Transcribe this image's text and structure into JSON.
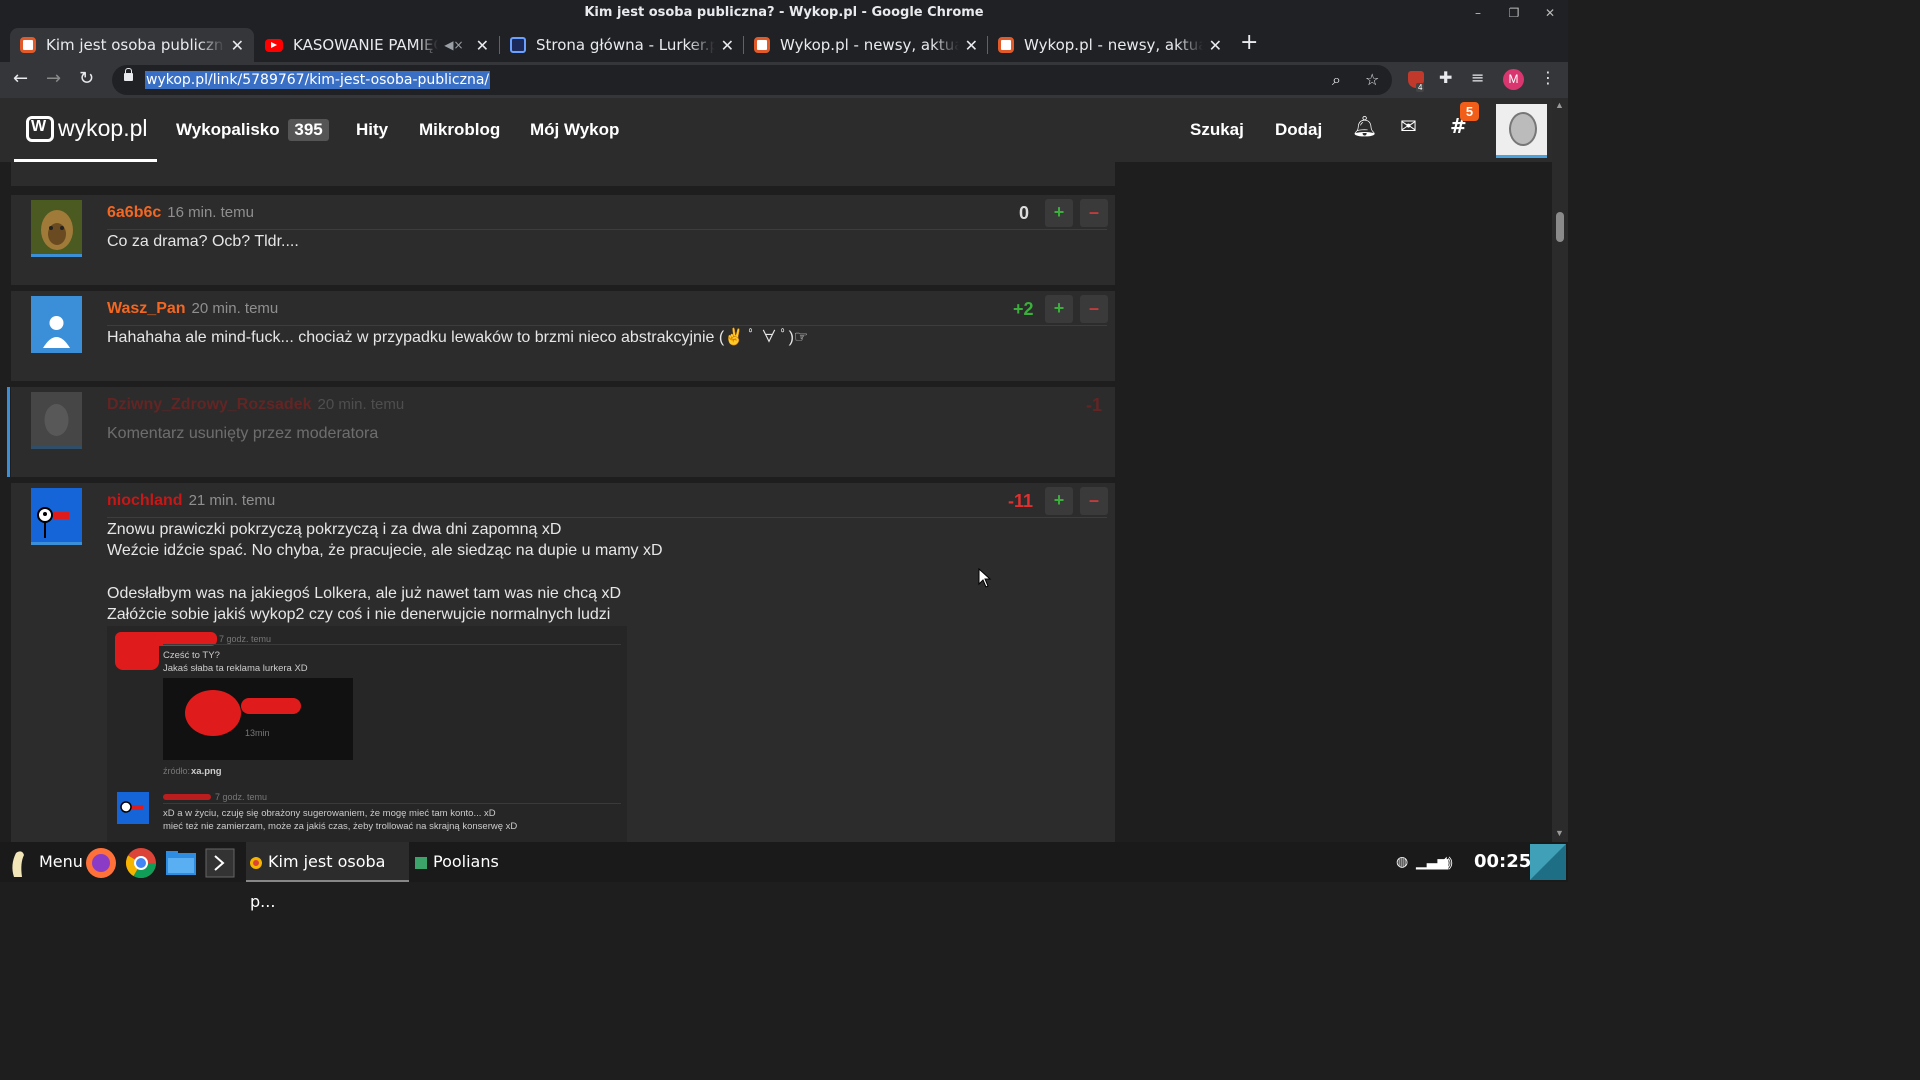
{
  "window": {
    "title": "Kim jest osoba publiczna? - Wykop.pl - Google Chrome"
  },
  "tabs": [
    {
      "label": "Kim jest osoba publiczna",
      "active": true,
      "icon": "wykop-favicon"
    },
    {
      "label": "KASOWANIE PAMIĘC",
      "active": false,
      "icon": "youtube-favicon",
      "muted": true
    },
    {
      "label": "Strona główna - Lurker.p",
      "active": false,
      "icon": "lurker-favicon"
    },
    {
      "label": "Wykop.pl - newsy, aktual",
      "active": false,
      "icon": "wykop-favicon"
    },
    {
      "label": "Wykop.pl - newsy, aktual",
      "active": false,
      "icon": "wykop-favicon"
    }
  ],
  "toolbar": {
    "url": "wykop.pl/link/5789767/kim-jest-osoba-publiczna/",
    "ublock_count": "4",
    "profile_initial": "M"
  },
  "site": {
    "logo_text": "wykop.pl",
    "nav": [
      {
        "label": "Wykopalisko",
        "badge": "395"
      },
      {
        "label": "Hity"
      },
      {
        "label": "Mikroblog"
      },
      {
        "label": "Mój Wykop"
      }
    ],
    "search_label": "Szukaj",
    "add_label": "Dodaj",
    "notif_count": "5"
  },
  "comments": [
    {
      "author": "6a6b6c",
      "time": "16 min. temu",
      "score": "0",
      "text": "Co za drama? Ocb? Tldr...."
    },
    {
      "author": "Wasz_Pan",
      "time": "20 min. temu",
      "score": "+2",
      "text": "Hahahaha ale mind-fuck... chociaż w przypadku lewaków to brzmi nieco abstrakcyjnie (✌ ﾟ ∀ ﾟ)☞"
    },
    {
      "author": "Dziwny_Zdrowy_Rozsadek",
      "time": "20 min. temu",
      "score": "-1",
      "text": "Komentarz usunięty przez moderatora",
      "deleted": true
    },
    {
      "author": "niochland",
      "time": "21 min. temu",
      "score": "-11",
      "lines": [
        "Znowu prawiczki pokrzyczą pokrzyczą i za dwa dni zapomną xD",
        "Weźcie idźcie spać. No chyba, że pracujecie, ale siedząc na dupie u mamy xD",
        "",
        "Odesłałbym was na jakiegoś Lolkera, ale już nawet tam was nie chcą xD",
        "Załóżcie sobie jakiś wykop2 czy coś i nie denerwujcie normalnych ludzi"
      ],
      "embed": {
        "c1_time": "7 godz. temu",
        "c1_line1": "Cześć to TY?",
        "c1_line2": "Jakaś słaba ta reklama lurkera XD",
        "img_caption": "13min",
        "source_label": "źródło:",
        "source_file": "xa.png",
        "c2_time": "7 godz. temu",
        "c2_line1": "xD a w życiu, czuję się obrażony sugerowaniem, że mogę mieć tam konto... xD",
        "c2_line2": "mieć też nie zamierzam, może za jakiś czas, żeby trollować na skrajną konserwę xD"
      }
    }
  ],
  "taskbar": {
    "menu_label": "Menu",
    "items": [
      {
        "label": "Kim jest osoba p..."
      },
      {
        "label": "Poolians"
      }
    ],
    "clock": "00:25"
  },
  "colors": {
    "accent_orange": "#f26722",
    "author_red": "#c91616",
    "plus_green": "#3cae3c",
    "minus_red": "#c73a3a"
  }
}
